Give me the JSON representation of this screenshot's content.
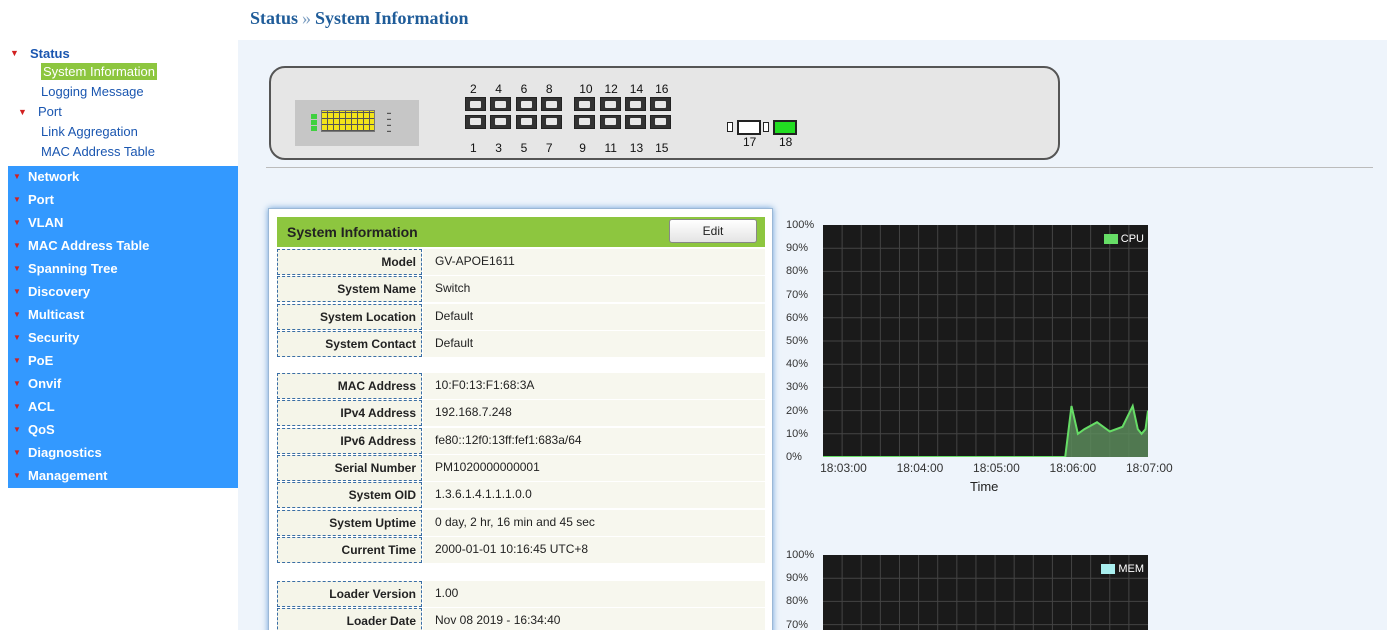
{
  "breadcrumb": {
    "section": "Status",
    "separator": "»",
    "page": "System Information"
  },
  "sidebar": {
    "status_label": "Status",
    "status_items": [
      {
        "label": "System Information",
        "active": true
      },
      {
        "label": "Logging Message",
        "active": false
      }
    ],
    "port_label": "Port",
    "port_items": [
      "Link Aggregation",
      "MAC Address Table"
    ],
    "menu": [
      "Network",
      "Port",
      "VLAN",
      "MAC Address Table",
      "Spanning Tree",
      "Discovery",
      "Multicast",
      "Security",
      "PoE",
      "Onvif",
      "ACL",
      "QoS",
      "Diagnostics",
      "Management"
    ]
  },
  "switch_panel": {
    "top_ports": [
      "2",
      "4",
      "6",
      "8",
      "10",
      "12",
      "14",
      "16"
    ],
    "bottom_ports": [
      "1",
      "3",
      "5",
      "7",
      "9",
      "11",
      "13",
      "15"
    ],
    "sfp_ports": [
      {
        "label": "17",
        "active": false
      },
      {
        "label": "18",
        "active": true
      }
    ]
  },
  "system_info": {
    "title": "System Information",
    "edit_label": "Edit",
    "group1": [
      {
        "label": "Model",
        "value": "GV-APOE1611"
      },
      {
        "label": "System Name",
        "value": "Switch"
      },
      {
        "label": "System Location",
        "value": "Default"
      },
      {
        "label": "System Contact",
        "value": "Default"
      }
    ],
    "group2": [
      {
        "label": "MAC Address",
        "value": "10:F0:13:F1:68:3A"
      },
      {
        "label": "IPv4 Address",
        "value": "192.168.7.248"
      },
      {
        "label": "IPv6 Address",
        "value": "fe80::12f0:13ff:fef1:683a/64"
      },
      {
        "label": "Serial Number",
        "value": "PM1020000000001"
      },
      {
        "label": "System OID",
        "value": "1.3.6.1.4.1.1.1.0.0"
      },
      {
        "label": "System Uptime",
        "value": "0 day, 2 hr, 16 min and 45 sec"
      },
      {
        "label": "Current Time",
        "value": "2000-01-01 10:16:45 UTC+8"
      }
    ],
    "group3": [
      {
        "label": "Loader Version",
        "value": "1.00"
      },
      {
        "label": "Loader Date",
        "value": "Nov 08 2019 - 16:34:40"
      }
    ]
  },
  "colors": {
    "accent_green": "#8dc63f",
    "sidebar_blue": "#3399ff",
    "link_blue": "#1a56b0",
    "cpu_series": "#66dd66",
    "mem_series": "#aaf0f0"
  },
  "chart_data": [
    {
      "type": "area",
      "legend": "CPU",
      "xlabel": "Time",
      "x_ticks": [
        "18:03:00",
        "18:04:00",
        "18:05:00",
        "18:06:00",
        "18:07:00"
      ],
      "y_ticks": [
        "100%",
        "90%",
        "80%",
        "70%",
        "60%",
        "50%",
        "40%",
        "30%",
        "20%",
        "10%",
        "0%"
      ],
      "ylim": [
        0,
        100
      ],
      "xlim": [
        "18:02:45",
        "18:07:00"
      ],
      "x": [
        "18:02:45",
        "18:05:55",
        "18:06:00",
        "18:06:05",
        "18:06:10",
        "18:06:20",
        "18:06:30",
        "18:06:40",
        "18:06:48",
        "18:06:52",
        "18:06:55",
        "18:06:58",
        "18:07:00"
      ],
      "values": [
        0,
        0,
        22,
        10,
        12,
        15,
        11,
        13,
        22,
        12,
        10,
        12,
        20
      ],
      "grid": true,
      "legend_position": "top-right"
    },
    {
      "type": "area",
      "legend": "MEM",
      "y_ticks": [
        "100%",
        "90%",
        "80%",
        "70%"
      ],
      "ylim": [
        0,
        100
      ],
      "grid": true,
      "legend_position": "top-right"
    }
  ]
}
